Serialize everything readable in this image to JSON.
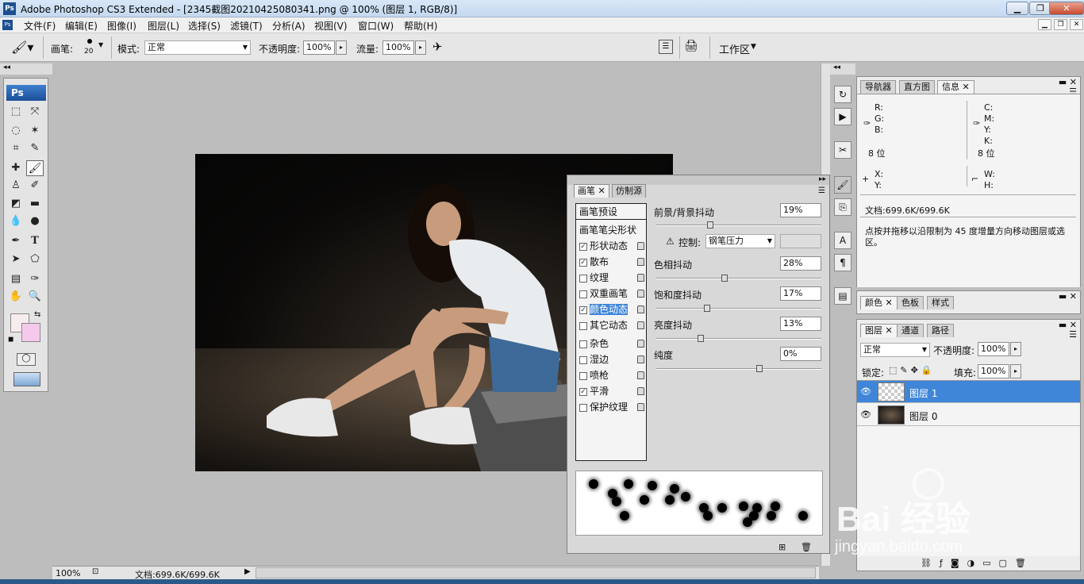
{
  "window": {
    "title": "Adobe Photoshop CS3 Extended - [2345截图20210425080341.png @ 100% (图层 1, RGB/8)]",
    "app_icon": "Ps"
  },
  "menu": [
    "文件(F)",
    "编辑(E)",
    "图像(I)",
    "图层(L)",
    "选择(S)",
    "滤镜(T)",
    "分析(A)",
    "视图(V)",
    "窗口(W)",
    "帮助(H)"
  ],
  "options": {
    "brush_label": "画笔:",
    "brush_size": "20",
    "mode_label": "模式:",
    "mode_value": "正常",
    "opacity_label": "不透明度:",
    "opacity_value": "100%",
    "flow_label": "流量:",
    "flow_value": "100%",
    "workspace": "工作区"
  },
  "toolbox": {
    "logo": "Ps"
  },
  "status": {
    "zoom": "100%",
    "doc": "文档:699.6K/699.6K"
  },
  "brush_panel": {
    "tabs": [
      "画笔",
      "仿制源"
    ],
    "header": "画笔预设",
    "section": "画笔笔尖形状",
    "items": [
      {
        "label": "形状动态",
        "checked": true
      },
      {
        "label": "散布",
        "checked": true
      },
      {
        "label": "纹理",
        "checked": false
      },
      {
        "label": "双重画笔",
        "checked": false
      },
      {
        "label": "颜色动态",
        "checked": true
      },
      {
        "label": "其它动态",
        "checked": false
      },
      {
        "label": "杂色",
        "checked": false
      },
      {
        "label": "湿边",
        "checked": false
      },
      {
        "label": "喷枪",
        "checked": false
      },
      {
        "label": "平滑",
        "checked": true
      },
      {
        "label": "保护纹理",
        "checked": false
      }
    ],
    "settings": {
      "fg_bg_label": "前景/背景抖动",
      "fg_bg_value": "19%",
      "fg_bg_level": 0.19,
      "control_label": "控制:",
      "control_value": "钢笔压力",
      "hue_label": "色相抖动",
      "hue_value": "28%",
      "hue_level": 0.28,
      "sat_label": "饱和度抖动",
      "sat_value": "17%",
      "sat_level": 0.17,
      "bright_label": "亮度抖动",
      "bright_value": "13%",
      "bright_level": 0.13,
      "purity_label": "纯度",
      "purity_value": "0%",
      "purity_level": 0.5
    }
  },
  "info_panel": {
    "tabs": [
      "导航器",
      "直方图",
      "信息"
    ],
    "rgb": [
      "R:",
      "G:",
      "B:"
    ],
    "cmyk": [
      "C:",
      "M:",
      "Y:",
      "K:"
    ],
    "bits_left": "8 位",
    "bits_right": "8 位",
    "xy": [
      "X:",
      "Y:"
    ],
    "wh": [
      "W:",
      "H:"
    ],
    "doc": "文档:699.6K/699.6K",
    "hint": "点按并拖移以沿限制为 45 度增量方向移动图层或选区。"
  },
  "color_panel": {
    "tabs": [
      "颜色",
      "色板",
      "样式"
    ]
  },
  "layers_panel": {
    "tabs": [
      "图层",
      "通道",
      "路径"
    ],
    "blend": "正常",
    "opacity_label": "不透明度:",
    "opacity_value": "100%",
    "lock_label": "锁定:",
    "fill_label": "填充:",
    "fill_value": "100%",
    "layers": [
      {
        "name": "图层 1",
        "selected": true
      },
      {
        "name": "图层 0",
        "selected": false
      }
    ]
  },
  "watermark": {
    "brand": "Bai 经验",
    "url": "jingyan.baidu.com"
  },
  "colors": {
    "accent": "#3f86d8",
    "fg_swatch": "#f7ecec",
    "bg_swatch": "#f5c9ec"
  }
}
